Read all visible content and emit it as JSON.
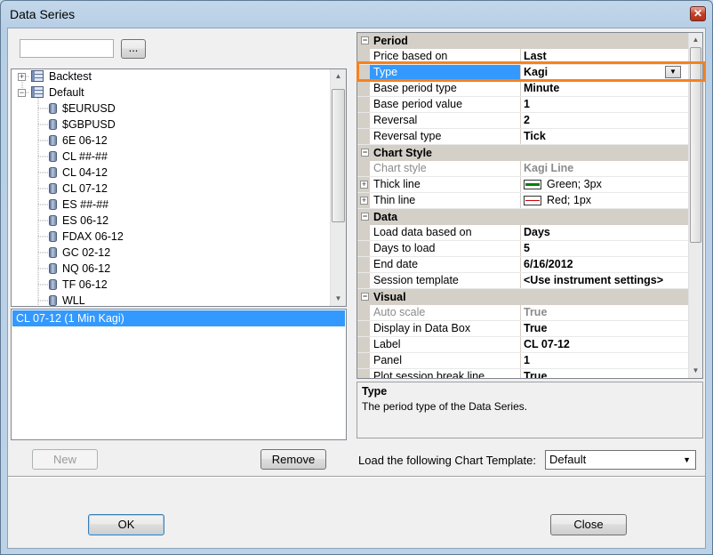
{
  "window": {
    "title": "Data Series",
    "close_glyph": "✕"
  },
  "search": {
    "value": "",
    "browse_label": "..."
  },
  "tree": {
    "folders": [
      {
        "label": "Backtest",
        "state": "+"
      },
      {
        "label": "Default",
        "state": "−"
      }
    ],
    "instruments": [
      "$EURUSD",
      "$GBPUSD",
      "6E 06-12",
      "CL ##-##",
      "CL 04-12",
      "CL 07-12",
      "ES ##-##",
      "ES 06-12",
      "FDAX 06-12",
      "GC 02-12",
      "NQ 06-12",
      "TF 06-12",
      "WLL"
    ]
  },
  "series_list": {
    "selected": "CL 07-12 (1 Min Kagi)"
  },
  "buttons": {
    "new": "New",
    "remove": "Remove",
    "ok": "OK",
    "close": "Close"
  },
  "properties": {
    "period": {
      "title": "Period",
      "rows": [
        {
          "name": "Price based on",
          "value": "Last"
        },
        {
          "name": "Type",
          "value": "Kagi"
        },
        {
          "name": "Base period type",
          "value": "Minute"
        },
        {
          "name": "Base period value",
          "value": "1"
        },
        {
          "name": "Reversal",
          "value": "2"
        },
        {
          "name": "Reversal type",
          "value": "Tick"
        }
      ]
    },
    "chart_style": {
      "title": "Chart Style",
      "rows": [
        {
          "name": "Chart style",
          "value": "Kagi Line"
        },
        {
          "name": "Thick line",
          "value": "Green; 3px"
        },
        {
          "name": "Thin line",
          "value": "Red; 1px"
        }
      ]
    },
    "data": {
      "title": "Data",
      "rows": [
        {
          "name": "Load data based on",
          "value": "Days"
        },
        {
          "name": "Days to load",
          "value": "5"
        },
        {
          "name": "End date",
          "value": "6/16/2012"
        },
        {
          "name": "Session template",
          "value": "<Use instrument settings>"
        }
      ]
    },
    "visual": {
      "title": "Visual",
      "rows": [
        {
          "name": "Auto scale",
          "value": "True"
        },
        {
          "name": "Display in Data Box",
          "value": "True"
        },
        {
          "name": "Label",
          "value": "CL 07-12"
        },
        {
          "name": "Panel",
          "value": "1"
        },
        {
          "name": "Plot session break line",
          "value": "True"
        }
      ]
    }
  },
  "colors": {
    "thick_line": "#008000",
    "thin_line": "#cc0000",
    "highlight": "#f58220",
    "selection": "#3399ff"
  },
  "description": {
    "title": "Type",
    "text": "The period type of the Data Series."
  },
  "chart_template": {
    "label": "Load the following Chart Template:",
    "value": "Default"
  },
  "icons": {
    "dropdown": "▼",
    "scroll_up": "▲",
    "scroll_down": "▼"
  }
}
